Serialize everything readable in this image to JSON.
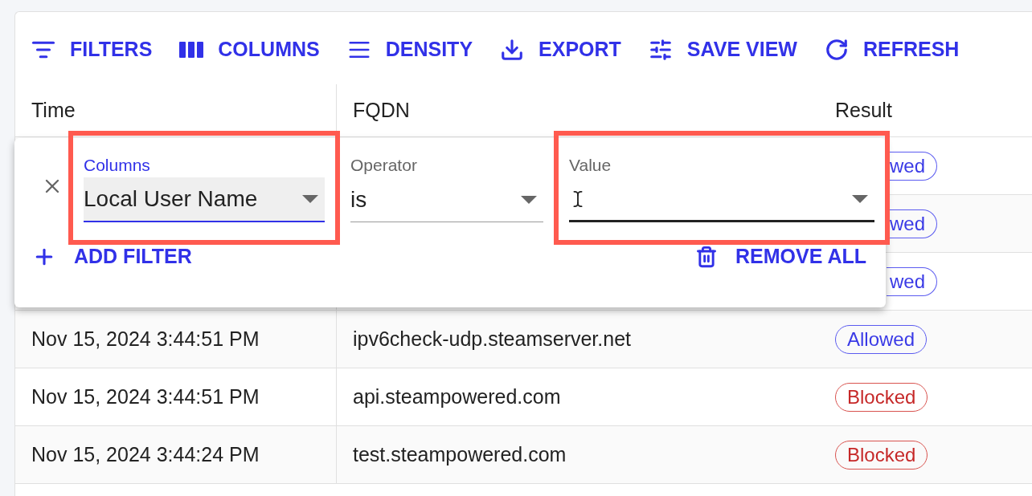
{
  "toolbar": [
    {
      "label": "FILTERS",
      "kind": "filters"
    },
    {
      "label": "COLUMNS",
      "kind": "columns"
    },
    {
      "label": "DENSITY",
      "kind": "density"
    },
    {
      "label": "EXPORT",
      "kind": "export"
    },
    {
      "label": "SAVE VIEW",
      "kind": "save_view"
    },
    {
      "label": "REFRESH",
      "kind": "refresh"
    }
  ],
  "table": {
    "columns": [
      "Time",
      "FQDN",
      "Result"
    ],
    "rows": [
      {
        "covered": true,
        "result": "wed",
        "kind": "allowed"
      },
      {
        "covered": true,
        "result": "wed",
        "kind": "allowed"
      },
      {
        "covered": true,
        "result": "wed",
        "kind": "allowed"
      },
      {
        "covered": false,
        "time": "Nov 15, 2024 3:44:51 PM",
        "fqdn": "ipv6check-udp.steamserver.net",
        "result": "Allowed",
        "kind": "allowed"
      },
      {
        "covered": false,
        "time": "Nov 15, 2024 3:44:51 PM",
        "fqdn": "api.steampowered.com",
        "result": "Blocked",
        "kind": "blocked"
      },
      {
        "covered": false,
        "time": "Nov 15, 2024 3:44:24 PM",
        "fqdn": "test.steampowered.com",
        "result": "Blocked",
        "kind": "blocked"
      }
    ]
  },
  "filter_panel": {
    "fields": [
      {
        "label": "Columns",
        "value": "Local User Name",
        "focused": true,
        "highlighted": true
      },
      {
        "label": "Operator",
        "value": "is",
        "focused": false,
        "highlighted": false
      },
      {
        "label": "Value",
        "focused": false,
        "hovered": true,
        "highlighted": true
      }
    ],
    "add_button": "ADD FILTER",
    "remove_button": "REMOVE ALL"
  }
}
